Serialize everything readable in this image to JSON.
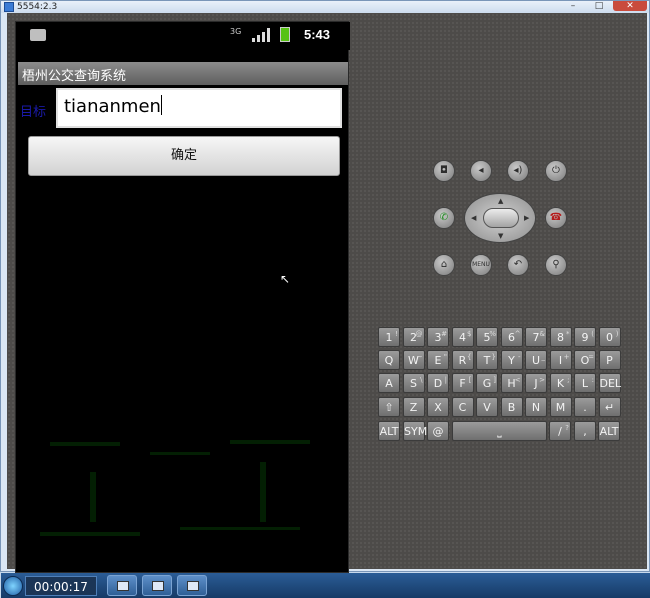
{
  "window": {
    "title": "5554:2.3",
    "minimize": "–",
    "maximize": "□",
    "close": "✕"
  },
  "status_bar": {
    "network": "3G",
    "time": "5:43"
  },
  "app": {
    "title": "梧州公交查询系统",
    "field_label": "目标",
    "field_value": "tiananmen",
    "confirm_button": "确定"
  },
  "hardware_buttons": {
    "camera": "camera-icon",
    "vol_down": "volume-down-icon",
    "vol_up": "volume-up-icon",
    "power": "power-icon",
    "call": "call-icon",
    "end": "end-call-icon",
    "home": "home-icon",
    "menu": "MENU",
    "back": "back-icon",
    "search": "search-icon"
  },
  "keyboard": {
    "row1": [
      "1",
      "2",
      "3",
      "4",
      "5",
      "6",
      "7",
      "8",
      "9",
      "0"
    ],
    "row1_alt": [
      "!",
      "@",
      "#",
      "$",
      "%",
      "^",
      "&",
      "*",
      "(",
      ")"
    ],
    "row2": [
      "Q",
      "W",
      "E",
      "R",
      "T",
      "Y",
      "U",
      "I",
      "O",
      "P"
    ],
    "row2_alt": [
      "",
      "~",
      "\"",
      "{",
      "}",
      "-",
      "_",
      "+",
      "="
    ],
    "row3": [
      "A",
      "S",
      "D",
      "F",
      "G",
      "H",
      "J",
      "K",
      "L",
      "DEL"
    ],
    "row3_alt": [
      "",
      "\\",
      "|",
      "[",
      "]",
      "<",
      ">",
      ";",
      ":"
    ],
    "row4": [
      "⇧",
      "Z",
      "X",
      "C",
      "V",
      "B",
      "N",
      "M",
      ".",
      "↵"
    ],
    "row5": [
      "ALT",
      "SYM",
      "@",
      "⎵",
      "/",
      "?",
      ",",
      "ALT"
    ]
  },
  "taskbar": {
    "timer": "00:00:17"
  }
}
